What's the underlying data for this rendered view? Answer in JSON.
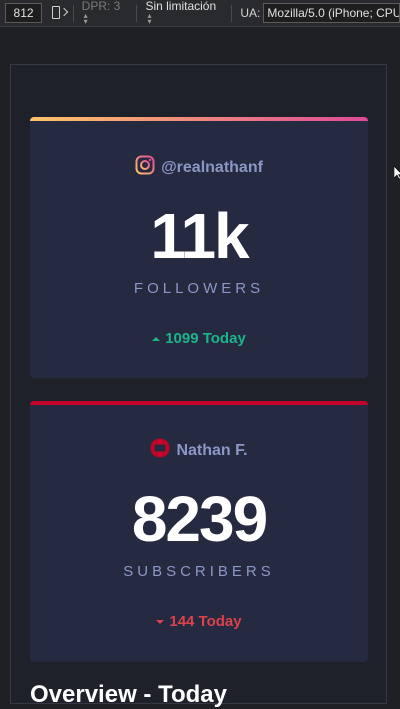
{
  "toolbar": {
    "width_value": "812",
    "dpr_label": "DPR: 3",
    "throttle_label": "Sin limitación",
    "ua_label": "UA:",
    "ua_value": "Mozilla/5.0 (iPhone; CPU"
  },
  "cards": [
    {
      "network_icon": "instagram-icon",
      "handle": "@realnathanf",
      "count": "11k",
      "unit": "FOLLOWERS",
      "delta": "1099 Today",
      "trend": "up",
      "accent": "#df4996"
    },
    {
      "network_icon": "youtube-icon",
      "handle": "Nathan F.",
      "count": "8239",
      "unit": "SUBSCRIBERS",
      "delta": "144 Today",
      "trend": "down",
      "accent": "#c4032a"
    }
  ],
  "overview_title": "Overview - Today",
  "colors": {
    "background": "#1e202a",
    "card": "#252a41",
    "muted_text": "#8b97c6",
    "up": "#1db489",
    "down": "#dc414c"
  }
}
